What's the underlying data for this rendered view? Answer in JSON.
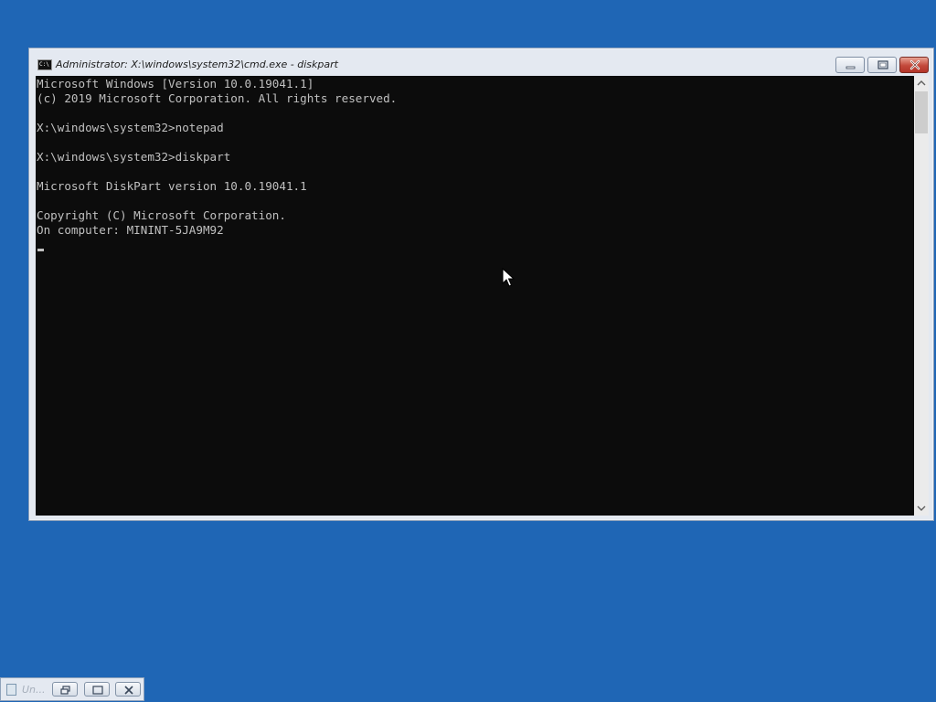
{
  "window": {
    "title": "Administrator: X:\\windows\\system32\\cmd.exe - diskpart",
    "icon": "cmd-icon",
    "icon_label": "C:\\"
  },
  "console": {
    "lines": [
      "Microsoft Windows [Version 10.0.19041.1]",
      "(c) 2019 Microsoft Corporation. All rights reserved.",
      "",
      "X:\\windows\\system32>notepad",
      "",
      "X:\\windows\\system32>diskpart",
      "",
      "Microsoft DiskPart version 10.0.19041.1",
      "",
      "Copyright (C) Microsoft Corporation.",
      "On computer: MININT-5JA9M92"
    ],
    "background": "#0c0c0c",
    "foreground": "#c0c0c0"
  },
  "minimized_window": {
    "title": "Un...",
    "icon": "notepad-icon"
  },
  "colors": {
    "desktop": "#1f66b5",
    "window_frame": "#e4e9f1",
    "close_button": "#c3493b"
  }
}
